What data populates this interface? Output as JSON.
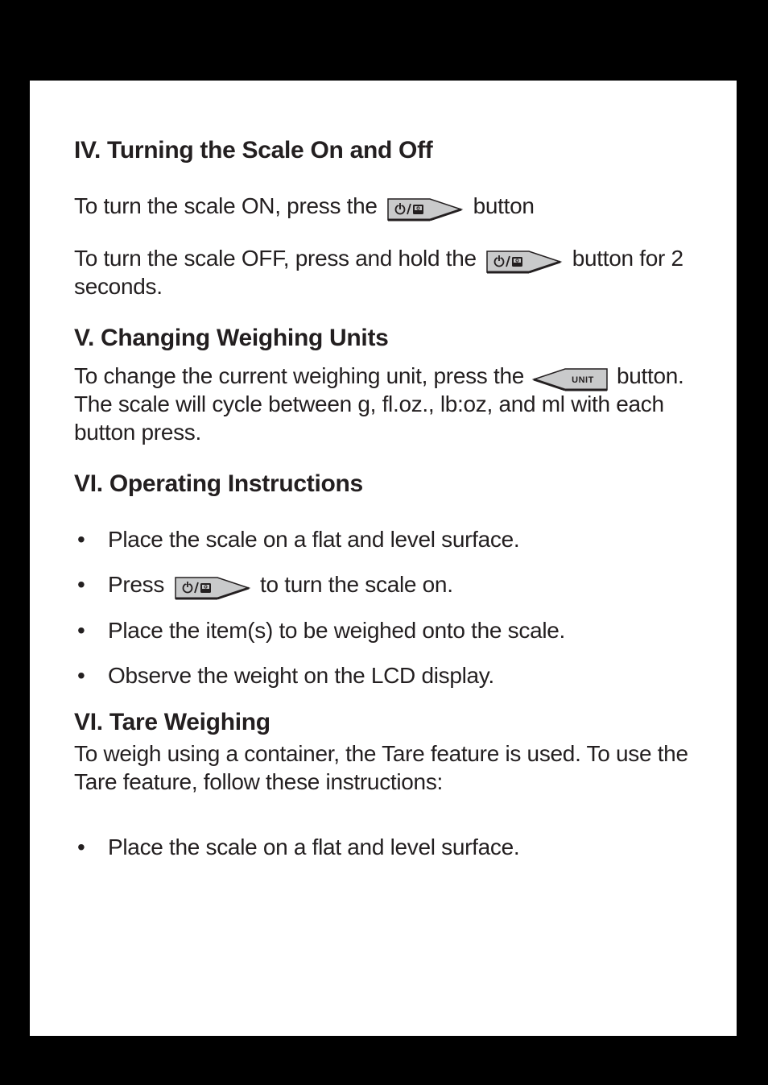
{
  "sections": {
    "iv": {
      "heading": "IV. Turning the Scale On and Off",
      "l1a": "To turn the scale ON, press the ",
      "l1b": " button",
      "l2a": "To turn the scale OFF, press and hold the ",
      "l2b": " button for 2 seconds."
    },
    "v": {
      "heading": "V. Changing Weighing Units",
      "l1a": "To change the current weighing unit, press the ",
      "l1b": " button. The scale will cycle between g, fl.oz., lb:oz, and ml with each button press."
    },
    "vi": {
      "heading": "VI. Operating Instructions",
      "bullets": {
        "b1": "Place the scale on a flat and level surface.",
        "b2a": "Press ",
        "b2b": " to turn the scale on.",
        "b3": "Place the item(s) to be weighed onto the scale.",
        "b4": "Observe the weight on the LCD display."
      }
    },
    "tare": {
      "heading": "VI. Tare Weighing",
      "intro": "To weigh using a container, the Tare feature is used. To use the Tare feature, follow these instructions:",
      "bullets": {
        "b1": "Place the scale on a flat and level surface."
      }
    }
  },
  "icons": {
    "unit_label": "UNIT"
  }
}
